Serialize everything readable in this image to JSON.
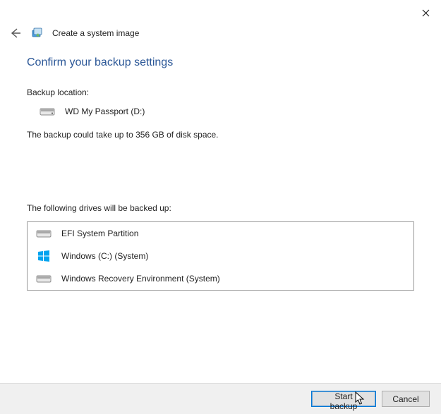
{
  "window": {
    "title": "Create a system image"
  },
  "heading": "Confirm your backup settings",
  "backup": {
    "location_label": "Backup location:",
    "location_name": "WD My Passport (D:)",
    "size_note": "The backup could take up to 356 GB of disk space."
  },
  "drives": {
    "section_label": "The following drives will be backed up:",
    "items": [
      {
        "name": "EFI System Partition"
      },
      {
        "name": "Windows (C:) (System)"
      },
      {
        "name": "Windows Recovery Environment (System)"
      }
    ]
  },
  "buttons": {
    "start": "Start backup",
    "cancel": "Cancel"
  }
}
